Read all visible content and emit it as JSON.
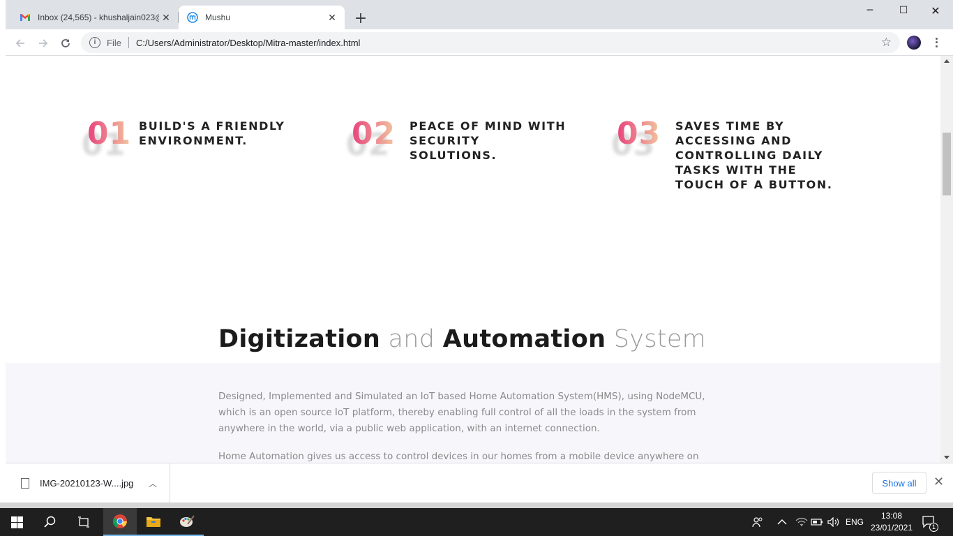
{
  "browser": {
    "tabs": [
      {
        "title": "Inbox (24,565) - khushaljain023@",
        "icon": "gmail-icon",
        "active": false
      },
      {
        "title": "Mushu",
        "icon": "mushu-logo-icon",
        "active": true
      }
    ],
    "address": {
      "scheme_label": "File",
      "url": "C:/Users/Administrator/Desktop/Mitra-master/index.html"
    }
  },
  "page": {
    "features": [
      {
        "number": "01",
        "text": "BUILD'S A FRIENDLY ENVIRONMENT."
      },
      {
        "number": "02",
        "text": "PEACE OF MIND WITH SECURITY SOLUTIONS."
      },
      {
        "number": "03",
        "text": "SAVES TIME BY ACCESSING AND CONTROLLING DAILY TASKS WITH THE TOUCH OF A BUTTON."
      }
    ],
    "heading": {
      "part1": "Digitization",
      "part2": "and",
      "part3": "Automation",
      "part4": "System"
    },
    "paragraphs": [
      "Designed, Implemented and Simulated an IoT based Home Automation System(HMS), using NodeMCU, which is an open source IoT platform, thereby enabling full control of all the loads in the system from anywhere in the world, via a public web application, with an internet connection.",
      "Home Automation gives us access to control devices in our homes from a mobile device anywhere on"
    ],
    "colors": {
      "gradient_start": "#e8437c",
      "gradient_end": "#f1c8a0"
    }
  },
  "downloads": {
    "file_name": "IMG-20210123-W....jpg",
    "show_all_label": "Show all"
  },
  "taskbar": {
    "language": "ENG",
    "time": "13:08",
    "date": "23/01/2021",
    "notification_count": "1"
  }
}
